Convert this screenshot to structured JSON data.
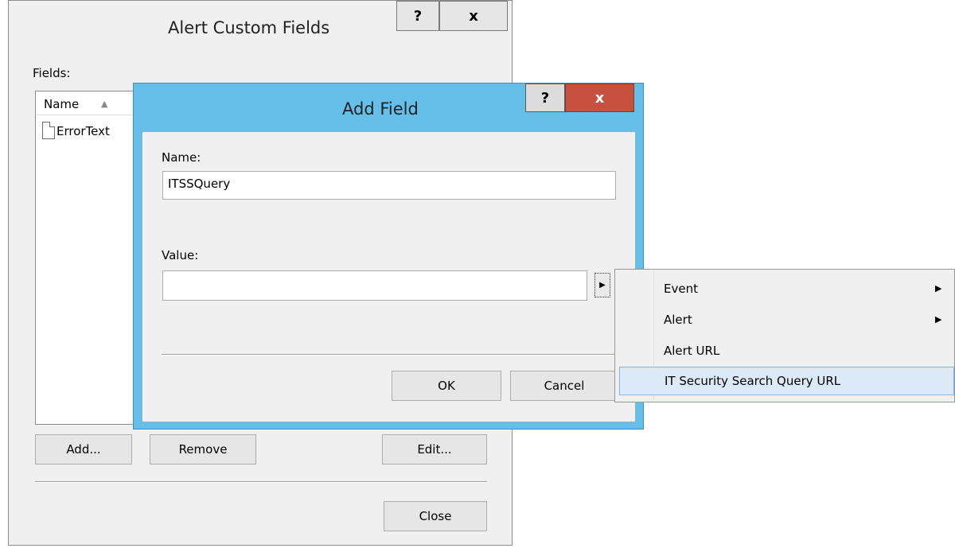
{
  "back_window": {
    "title": "Alert Custom Fields",
    "help_button": "?",
    "close_button": "x",
    "fields_label": "Fields:",
    "list": {
      "columns": [
        "Name"
      ],
      "rows": [
        {
          "name": "ErrorText"
        }
      ]
    },
    "buttons": {
      "add": "Add...",
      "remove": "Remove",
      "edit": "Edit...",
      "close": "Close"
    }
  },
  "front_dialog": {
    "title": "Add Field",
    "help_button": "?",
    "close_button": "x",
    "name_label": "Name:",
    "name_value": "ITSSQuery",
    "value_label": "Value:",
    "value_value": "",
    "insert_button_glyph": "▶",
    "buttons": {
      "ok": "OK",
      "cancel": "Cancel"
    },
    "accent_color": "#65bfe8",
    "close_color": "#c7503e"
  },
  "context_menu": {
    "items": [
      {
        "label": "Event",
        "has_submenu": true
      },
      {
        "label": "Alert",
        "has_submenu": true
      },
      {
        "label": "Alert URL",
        "has_submenu": false
      },
      {
        "label": "IT Security Search Query URL",
        "has_submenu": false,
        "highlighted": true
      }
    ],
    "submenu_glyph": "▶",
    "highlight_color": "#dceaf7"
  },
  "icons": {
    "sort": "▲",
    "file": "file-icon"
  }
}
